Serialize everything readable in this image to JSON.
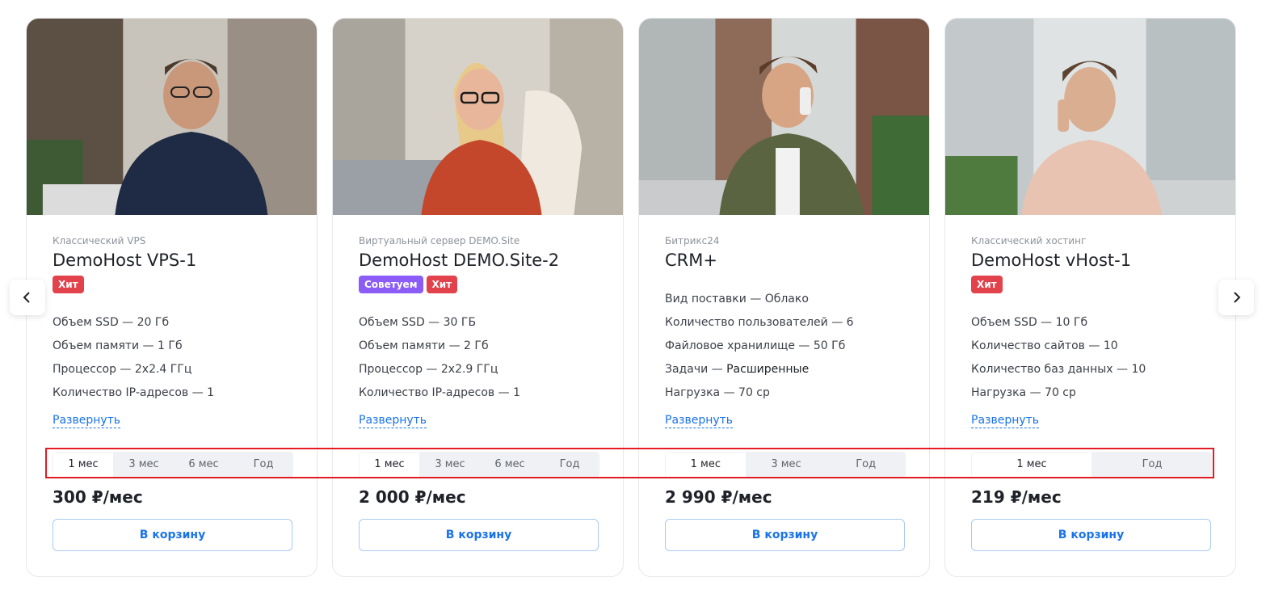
{
  "nav": {
    "prev_icon": "chevron-left-icon",
    "next_icon": "chevron-right-icon"
  },
  "cards": [
    {
      "category": "Классический VPS",
      "title": "DemoHost VPS-1",
      "badges": [
        "Хит"
      ],
      "specs": [
        {
          "label": "Объем SSD",
          "sep": " — ",
          "value": "20 Гб"
        },
        {
          "label": "Объем памяти",
          "sep": " — ",
          "value": "1 Гб"
        },
        {
          "label": "Процессор",
          "sep": " — ",
          "value": "2x2.4 ГГц"
        },
        {
          "label": "Количество IP-адресов",
          "sep": " — ",
          "value": "1"
        }
      ],
      "expand": "Развернуть",
      "periods": [
        "1 мес",
        "3 мес",
        "6 мес",
        "Год"
      ],
      "price": "300 ₽/мес",
      "cart": "В корзину"
    },
    {
      "category": "Виртуальный сервер DEMO.Site",
      "title": "DemoHost DEMO.Site-2",
      "badges": [
        "Советуем",
        "Хит"
      ],
      "specs": [
        {
          "label": "Объем SSD",
          "sep": " — ",
          "value": "30 ГБ"
        },
        {
          "label": "Объем памяти",
          "sep": " — ",
          "value": "2 Гб"
        },
        {
          "label": "Процессор",
          "sep": " — ",
          "value": "2x2.9 ГГц"
        },
        {
          "label": "Количество IP-адресов",
          "sep": " — ",
          "value": "1"
        }
      ],
      "expand": "Развернуть",
      "periods": [
        "1 мес",
        "3 мес",
        "6 мес",
        "Год"
      ],
      "price": "2 000 ₽/мес",
      "cart": "В корзину"
    },
    {
      "category": "Битрикс24",
      "title": "CRM+",
      "badges": [],
      "specs": [
        {
          "label": "Вид поставки",
          "sep": " — ",
          "value": "Облако"
        },
        {
          "label": "Количество пользователей",
          "sep": " — ",
          "value": "6"
        },
        {
          "label": "Файловое хранилище",
          "sep": " — ",
          "value": "50 Гб"
        },
        {
          "label": "Задачи",
          "sep": " — ",
          "value": "Расширенные"
        },
        {
          "label": "Нагрузка",
          "sep": " — ",
          "value": "70 ср"
        }
      ],
      "expand": "Развернуть",
      "periods": [
        "1 мес",
        "3 мес",
        "Год"
      ],
      "price": "2 990 ₽/мес",
      "cart": "В корзину"
    },
    {
      "category": "Классический хостинг",
      "title": "DemoHost vHost-1",
      "badges": [
        "Хит"
      ],
      "specs": [
        {
          "label": "Объем SSD",
          "sep": " — ",
          "value": "10 Гб"
        },
        {
          "label": "Количество сайтов",
          "sep": " — ",
          "value": "10"
        },
        {
          "label": "Количество баз данных",
          "sep": " — ",
          "value": "10"
        },
        {
          "label": "Нагрузка",
          "sep": " — ",
          "value": "70 ср"
        }
      ],
      "expand": "Развернуть",
      "periods": [
        "1 мес",
        "Год"
      ],
      "price": "219 ₽/мес",
      "cart": "В корзину"
    }
  ],
  "colors": {
    "accent": "#1a73e8",
    "hit": "#e2424b",
    "advise": "#8b5cf6",
    "highlight": "#e31b23"
  }
}
